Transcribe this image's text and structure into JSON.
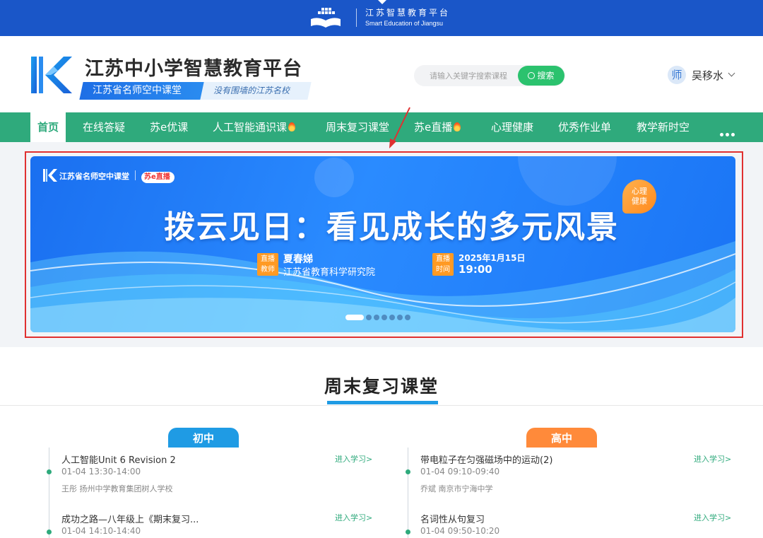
{
  "portal": {
    "name_cn": "江苏智慧教育平台",
    "name_en": "Smart Education of Jiangsu"
  },
  "header": {
    "site_title": "江苏中小学智慧教育平台",
    "sub_tag": "江苏省名师空中课堂",
    "slogan": "没有围墙的江苏名校",
    "search_placeholder": "请输入关键字搜索课程",
    "search_button": "搜索",
    "avatar_char": "师",
    "username": "吴移水"
  },
  "nav": {
    "items": [
      {
        "label": "首页",
        "active": true
      },
      {
        "label": "在线答疑"
      },
      {
        "label": "苏e优课"
      },
      {
        "label": "人工智能通识课",
        "hot": true
      },
      {
        "label": "周末复习课堂"
      },
      {
        "label": "苏e直播",
        "hot": true
      },
      {
        "label": "心理健康"
      },
      {
        "label": "优秀作业单"
      },
      {
        "label": "教学新时空"
      }
    ]
  },
  "banner": {
    "brand": "江苏省名师空中课堂",
    "live_brand": "苏e直播",
    "headline": "拨云见日：看见成长的多元风景",
    "category_badge": "心理健康",
    "teacher_tag": "直播教师",
    "teacher_name": "夏春娣",
    "teacher_org": "江苏省教育科学研究院",
    "time_tag": "直播时间",
    "date": "2025年1月15日",
    "time": "19:00",
    "slide_count": 7,
    "active_slide": 0
  },
  "section": {
    "title": "周末复习课堂",
    "tab_mid": "初中",
    "tab_high": "高中"
  },
  "courses_mid": [
    {
      "title": "人工智能Unit 6 Revision 2",
      "time": "01-04 13:30-14:00",
      "teacher": "王彤    扬州中学教育集团树人学校",
      "enter": "进入学习>"
    },
    {
      "title": "成功之路—八年级上《期末复习...",
      "time": "01-04 14:10-14:40",
      "teacher": "",
      "enter": "进入学习>"
    }
  ],
  "courses_high": [
    {
      "title": "带电粒子在匀强磁场中的运动(2)",
      "time": "01-04 09:10-09:40",
      "teacher": "乔斌    南京市宁海中学",
      "enter": "进入学习>"
    },
    {
      "title": "名词性从句复习",
      "time": "01-04 09:50-10:20",
      "teacher": "",
      "enter": "进入学习>"
    }
  ]
}
